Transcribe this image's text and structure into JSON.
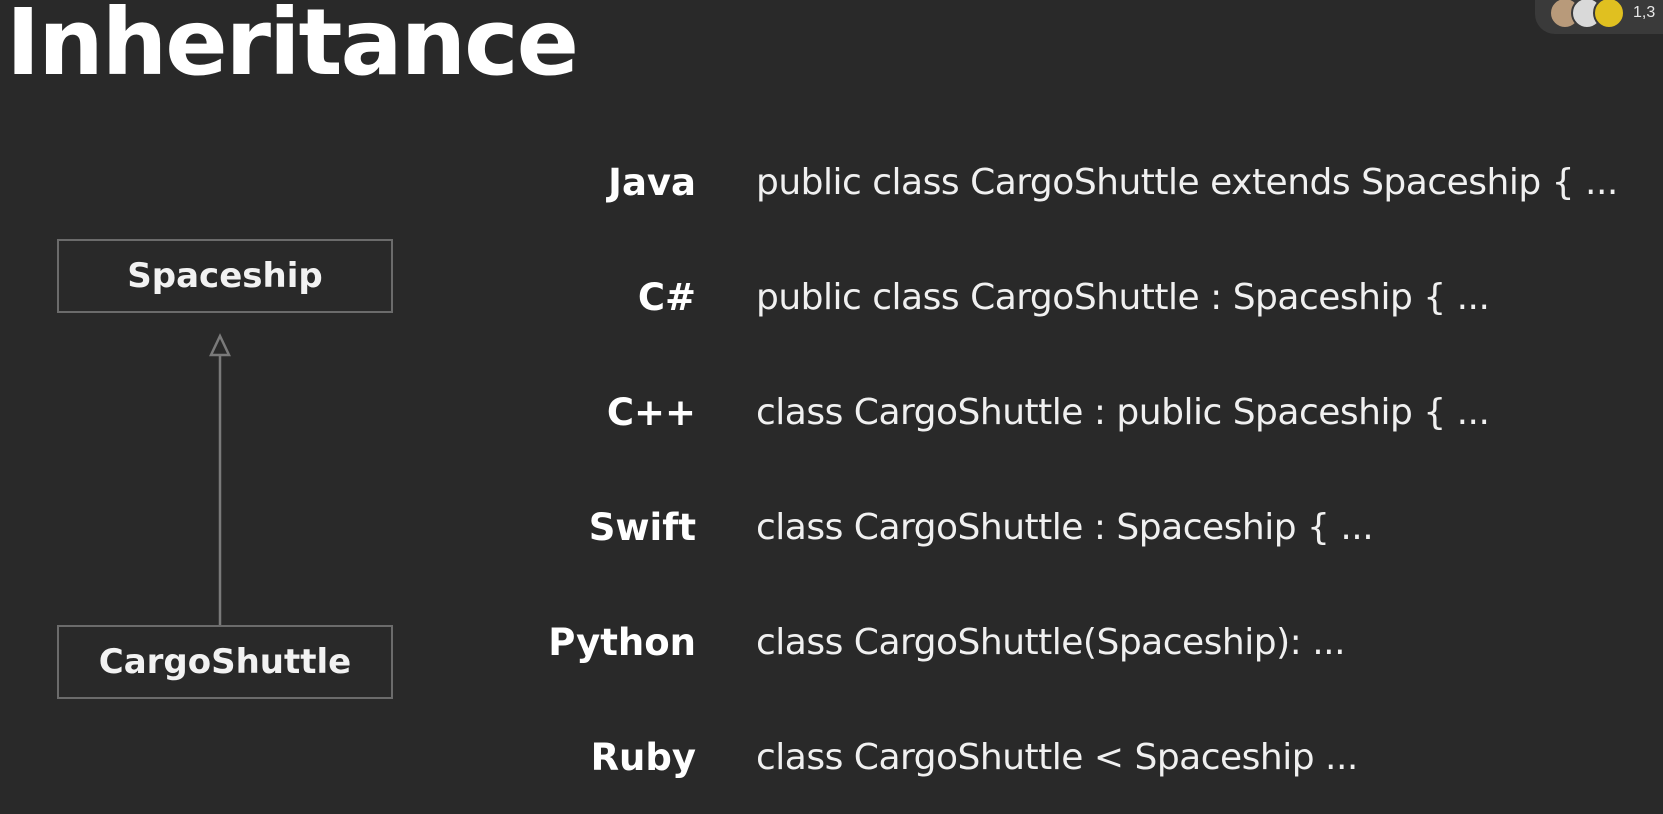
{
  "slide": {
    "title": "Inheritance"
  },
  "diagram": {
    "parent_class": "Spaceship",
    "child_class": "CargoShuttle",
    "arrow_color": "#7a7a7a",
    "box_border_color": "#6b6b6b"
  },
  "languages": [
    {
      "name": "Java",
      "code": "public class CargoShuttle extends Spaceship { ..."
    },
    {
      "name": "C#",
      "code": "public class CargoShuttle : Spaceship { ..."
    },
    {
      "name": "C++",
      "code": "class CargoShuttle : public Spaceship { ..."
    },
    {
      "name": "Swift",
      "code": "class CargoShuttle : Spaceship { ..."
    },
    {
      "name": "Python",
      "code": "class CargoShuttle(Spaceship): ..."
    },
    {
      "name": "Ruby",
      "code": "class CargoShuttle < Spaceship ..."
    }
  ],
  "participants": {
    "count": "1,3",
    "avatars": [
      {
        "icon": "participant-avatar-icon",
        "color": "#b89a7a"
      },
      {
        "icon": "participant-avatar-icon",
        "color": "#d9d9d9"
      },
      {
        "icon": "participant-avatar-icon",
        "color": "#e0c020"
      }
    ]
  },
  "colors": {
    "background": "#292929",
    "text": "#ffffff"
  }
}
